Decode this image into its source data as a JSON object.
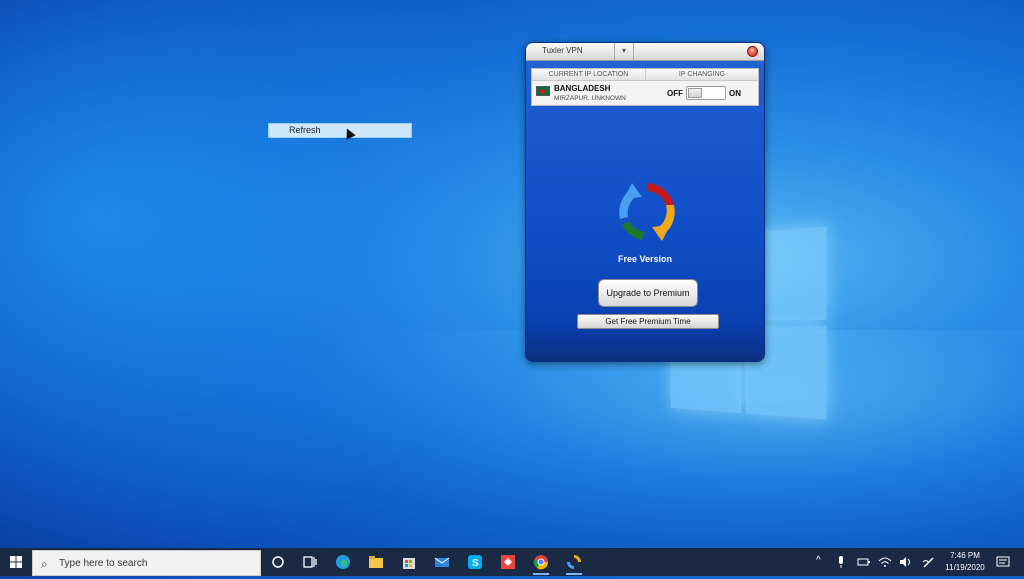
{
  "context_menu": {
    "refresh_label": "Refresh"
  },
  "vpn": {
    "title": "Tuxler VPN",
    "dropdown_glyph": "▾",
    "close_glyph": "×",
    "current_ip_header": "CURRENT IP LOCATION",
    "ip_changing_header": "IP CHANGING",
    "country": "BANGLADESH",
    "city": "MIRZAPUR, UNKNOWN",
    "toggle_off": "OFF",
    "toggle_on": "ON",
    "toggle_state": "off",
    "version_label": "Free Version",
    "upgrade_label": "Upgrade to Premium",
    "free_time_label": "Get Free Premium Time"
  },
  "taskbar": {
    "search_placeholder": "Type here to search",
    "search_glyph": "⌕",
    "time": "7:46 PM",
    "date": "11/19/2020",
    "apps": [
      "cortana-icon",
      "task-view-icon",
      "edge-icon",
      "file-explorer-icon",
      "store-icon",
      "mail-icon",
      "skype-icon",
      "anydesk-icon",
      "chrome-icon",
      "tuxler-icon"
    ],
    "tray": [
      "chevron-up-icon",
      "microphone-icon",
      "battery-icon",
      "wifi-icon",
      "volume-icon",
      "pen-icon"
    ]
  }
}
